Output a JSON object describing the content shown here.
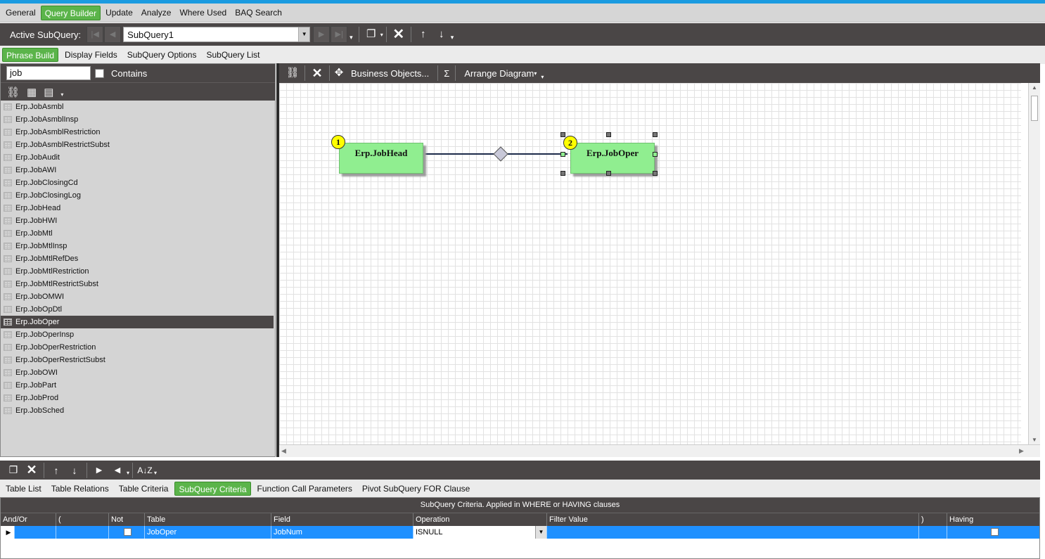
{
  "menu": [
    "General",
    "Query Builder",
    "Update",
    "Analyze",
    "Where Used",
    "BAQ Search"
  ],
  "active_menu": "Query Builder",
  "subquery_toolbar": {
    "label": "Active SubQuery:",
    "selected": "SubQuery1"
  },
  "subtabs": [
    "Phrase Build",
    "Display Fields",
    "SubQuery Options",
    "SubQuery List"
  ],
  "active_subtab": "Phrase Build",
  "search": {
    "value": "job",
    "contains_label": "Contains"
  },
  "tables": [
    "Erp.JobAsmbl",
    "Erp.JobAsmblInsp",
    "Erp.JobAsmblRestriction",
    "Erp.JobAsmblRestrictSubst",
    "Erp.JobAudit",
    "Erp.JobAWI",
    "Erp.JobClosingCd",
    "Erp.JobClosingLog",
    "Erp.JobHead",
    "Erp.JobHWI",
    "Erp.JobMtl",
    "Erp.JobMtlInsp",
    "Erp.JobMtlRefDes",
    "Erp.JobMtlRestriction",
    "Erp.JobMtlRestrictSubst",
    "Erp.JobOMWI",
    "Erp.JobOpDtl",
    "Erp.JobOper",
    "Erp.JobOperInsp",
    "Erp.JobOperRestriction",
    "Erp.JobOperRestrictSubst",
    "Erp.JobOWI",
    "Erp.JobPart",
    "Erp.JobProd",
    "Erp.JobSched"
  ],
  "selected_table": "Erp.JobOper",
  "diagram_toolbar": {
    "business_objects": "Business Objects...",
    "sigma": "Σ",
    "arrange": "Arrange Diagram"
  },
  "diagram": {
    "nodes": [
      {
        "num": "1",
        "name": "Erp.JobHead"
      },
      {
        "num": "2",
        "name": "Erp.JobOper"
      }
    ],
    "box_color": "#90ee90",
    "badge_color": "#ffff00"
  },
  "bottom_tabs": [
    "Table List",
    "Table Relations",
    "Table Criteria",
    "SubQuery Criteria",
    "Function Call Parameters",
    "Pivot SubQuery FOR Clause"
  ],
  "active_bottom_tab": "SubQuery Criteria",
  "criteria": {
    "caption": "SubQuery Criteria. Applied in WHERE or HAVING clauses",
    "headers": {
      "andor": "And/Or",
      "lparen": "(",
      "not": "Not",
      "table": "Table",
      "field": "Field",
      "operation": "Operation",
      "filter": "Filter Value",
      "rparen": ")",
      "having": "Having"
    },
    "row": {
      "table": "JobOper",
      "field": "JobNum",
      "operation": "ISNULL"
    }
  },
  "colors": {
    "accent_green": "#5bb44a",
    "toolbar_dark": "#4a4646",
    "selection_blue": "#1e90ff"
  }
}
